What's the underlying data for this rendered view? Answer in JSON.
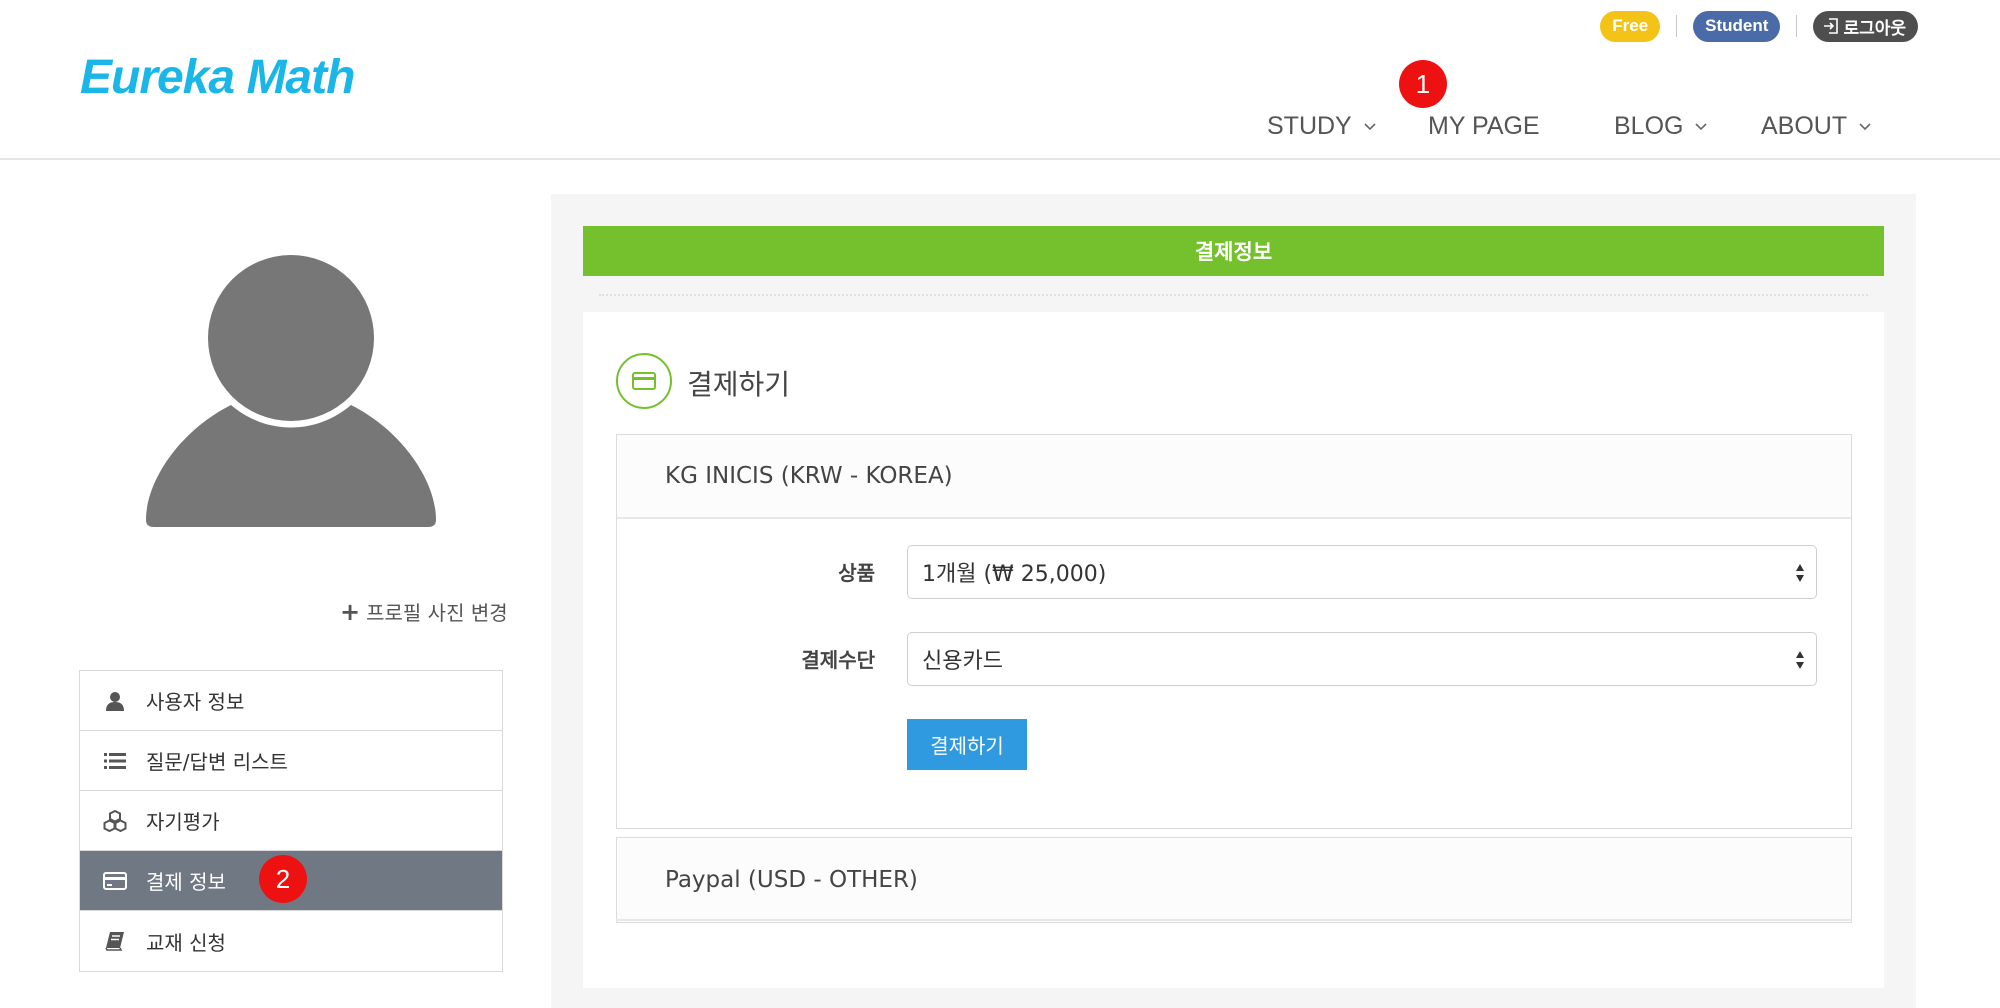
{
  "brand": {
    "logo": "Eureka Math",
    "logo_color": "#1ab6e8"
  },
  "topbar": {
    "free_badge": "Free",
    "student_badge": "Student",
    "logout_label": "로그아웃"
  },
  "nav": [
    {
      "label": "STUDY",
      "has_dropdown": true
    },
    {
      "label": "MY PAGE",
      "has_dropdown": false
    },
    {
      "label": "BLOG",
      "has_dropdown": true
    },
    {
      "label": "ABOUT",
      "has_dropdown": true
    }
  ],
  "markers": {
    "m1": "1",
    "m2": "2"
  },
  "profile": {
    "change_photo_label": "프로필 사진 변경"
  },
  "sidebar": {
    "items": [
      {
        "label": "사용자 정보",
        "icon": "user-icon",
        "active": false
      },
      {
        "label": "질문/답변 리스트",
        "icon": "list-icon",
        "active": false
      },
      {
        "label": "자기평가",
        "icon": "cubes-icon",
        "active": false
      },
      {
        "label": "결제 정보",
        "icon": "credit-card-icon",
        "active": true
      },
      {
        "label": "교재 신청",
        "icon": "book-icon",
        "active": false
      }
    ]
  },
  "main": {
    "banner": "결제정보",
    "banner_color": "#74c02d",
    "section_title": "결제하기",
    "providers": [
      {
        "label": "KG INICIS (KRW - KOREA)",
        "expanded": true
      },
      {
        "label": "Paypal (USD - OTHER)",
        "expanded": false
      }
    ],
    "form": {
      "product_label": "상품",
      "product_value": "1개월 (₩ 25,000)",
      "method_label": "결제수단",
      "method_value": "신용카드",
      "submit_label": "결제하기",
      "submit_color": "#2f9ae0"
    }
  }
}
